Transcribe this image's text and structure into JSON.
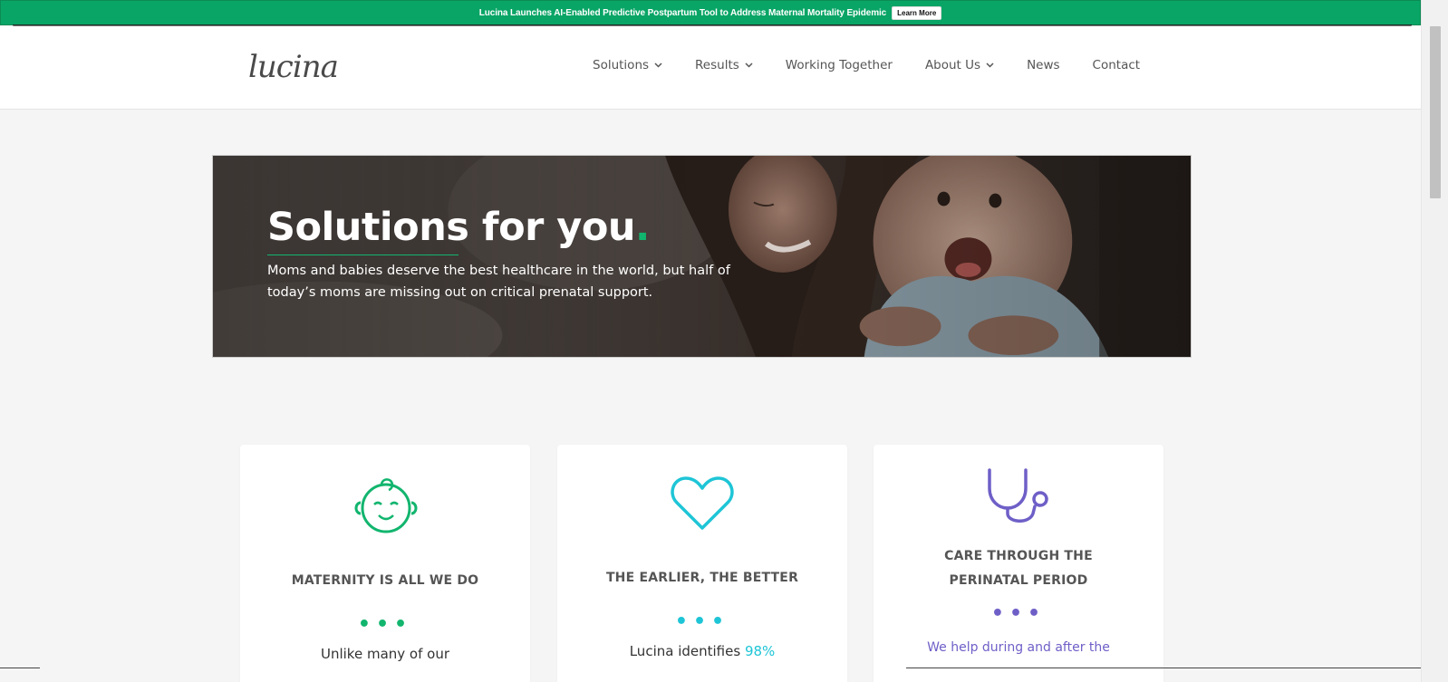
{
  "banner": {
    "text": "Lucina Launches AI-Enabled Predictive Postpartum Tool to Address Maternal Mortality Epidemic",
    "button_label": "Learn More"
  },
  "header": {
    "logo_text": "lucina",
    "nav": [
      {
        "label": "Solutions",
        "dropdown": true
      },
      {
        "label": "Results",
        "dropdown": true
      },
      {
        "label": "Working Together",
        "dropdown": false
      },
      {
        "label": "About Us",
        "dropdown": true
      },
      {
        "label": "News",
        "dropdown": false
      },
      {
        "label": "Contact",
        "dropdown": false
      }
    ]
  },
  "hero": {
    "title": "Solutions for you",
    "title_dot": ".",
    "subtitle_line1": "Moms and babies deserve the best healthcare in the world, but half of",
    "subtitle_line2": "today’s moms are missing out on critical prenatal support."
  },
  "cards": [
    {
      "icon": "baby-face-icon",
      "title": "MATERNITY IS ALL WE DO",
      "text": "Unlike many of our",
      "color": "#12b56e"
    },
    {
      "icon": "heart-icon",
      "title": "THE EARLIER, THE BETTER",
      "text_prefix": "Lucina identifies ",
      "text_highlight": "98%",
      "color": "#1ec5d6"
    },
    {
      "icon": "stethoscope-icon",
      "title_line1": "CARE THROUGH THE",
      "title_line2": "PERINATAL PERIOD",
      "text": "We help during and after the",
      "color": "#6e5fc7"
    }
  ],
  "colors": {
    "brand_green": "#09a566",
    "accent_green": "#12b56e",
    "accent_teal": "#1ec5d6",
    "accent_purple": "#6e5fc7"
  }
}
